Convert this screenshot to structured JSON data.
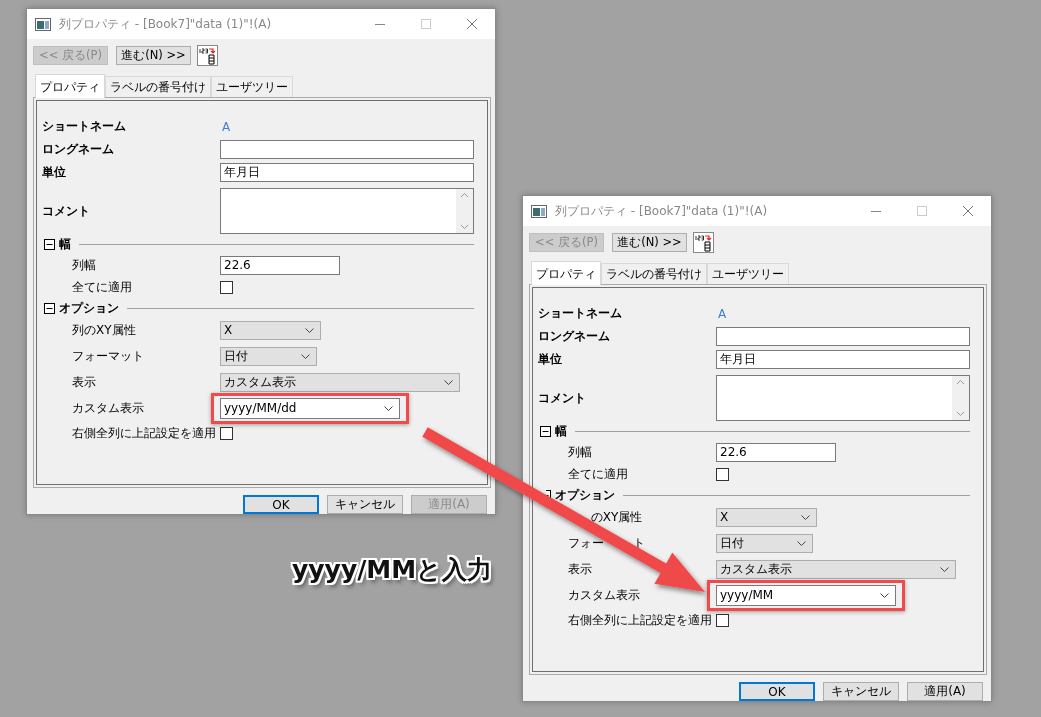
{
  "windows": [
    {
      "title": "列プロパティ - [Book7]\"data (1)\"!(A)",
      "nav_buttons": [
        {
          "label": "<< 戻る(P)",
          "disabled": true
        },
        {
          "label": "進む(N) >>",
          "disabled": false
        }
      ],
      "tabs": [
        {
          "label": "プロパティ",
          "selected": true
        },
        {
          "label": "ラベルの番号付け",
          "selected": false
        },
        {
          "label": "ユーザツリー",
          "selected": false
        }
      ],
      "properties": [
        {
          "kind": "static",
          "label": "ショートネーム",
          "value": "A"
        },
        {
          "kind": "text",
          "label": "ロングネーム"
        },
        {
          "kind": "text",
          "label": "単位",
          "value": "年月日"
        },
        {
          "kind": "memo",
          "label": "コメント"
        }
      ],
      "sections": [
        {
          "title": "幅",
          "expanded": true,
          "items": [
            {
              "kind": "text",
              "label": "列幅",
              "value": "22.6"
            },
            {
              "kind": "check",
              "label": "全てに適用",
              "checked": false
            }
          ]
        },
        {
          "title": "オプション",
          "expanded": true,
          "items": [
            {
              "kind": "select",
              "label": "列のXY属性",
              "value": "X"
            },
            {
              "kind": "select",
              "label": "フォーマット",
              "value": "日付"
            },
            {
              "kind": "select",
              "label": "表示",
              "value": "カスタム表示"
            },
            {
              "kind": "combo",
              "label": "カスタム表示",
              "value": "yyyy/MM/dd",
              "highlighted": true
            },
            {
              "kind": "check",
              "label": "右側全列に上記設定を適用",
              "checked": false
            }
          ]
        }
      ],
      "buttons": [
        {
          "label": "OK",
          "default": true,
          "disabled": false
        },
        {
          "label": "キャンセル",
          "default": false,
          "disabled": false
        },
        {
          "label": "適用(A)",
          "default": false,
          "disabled": true
        }
      ]
    },
    {
      "title": "列プロパティ - [Book7]\"data (1)\"!(A)",
      "nav_buttons": [
        {
          "label": "<< 戻る(P)",
          "disabled": true
        },
        {
          "label": "進む(N) >>",
          "disabled": false
        }
      ],
      "tabs": [
        {
          "label": "プロパティ",
          "selected": true
        },
        {
          "label": "ラベルの番号付け",
          "selected": false
        },
        {
          "label": "ユーザツリー",
          "selected": false
        }
      ],
      "properties": [
        {
          "kind": "static",
          "label": "ショートネーム",
          "value": "A"
        },
        {
          "kind": "text",
          "label": "ロングネーム"
        },
        {
          "kind": "text",
          "label": "単位",
          "value": "年月日"
        },
        {
          "kind": "memo",
          "label": "コメント"
        }
      ],
      "sections": [
        {
          "title": "幅",
          "expanded": true,
          "items": [
            {
              "kind": "text",
              "label": "列幅",
              "value": "22.6"
            },
            {
              "kind": "check",
              "label": "全てに適用",
              "checked": false
            }
          ]
        },
        {
          "title": "オプション",
          "expanded": true,
          "icon_covered": true,
          "items": [
            {
              "kind": "select",
              "label_parts": [
                {
                  "text": "のXY属性",
                  "covered_before": true
                }
              ],
              "value": "X"
            },
            {
              "kind": "select",
              "label_parts": [
                {
                  "text": "フォー",
                  "covered_before": false
                },
                {
                  "text": "ト",
                  "covered_before": true
                }
              ],
              "value": "日付"
            },
            {
              "kind": "select",
              "label": "表示",
              "value": "カスタム表示"
            },
            {
              "kind": "combo",
              "label": "カスタム表示",
              "value": "yyyy/MM",
              "highlighted": true
            },
            {
              "kind": "check",
              "label": "右側全列に上記設定を適用",
              "checked": false
            }
          ]
        }
      ],
      "buttons": [
        {
          "label": "OK",
          "default": true,
          "disabled": false
        },
        {
          "label": "キャンセル",
          "default": false,
          "disabled": false
        },
        {
          "label": "適用(A)",
          "default": false,
          "disabled": false
        }
      ]
    }
  ],
  "annotation": {
    "text": "yyyy/MMと入力"
  }
}
